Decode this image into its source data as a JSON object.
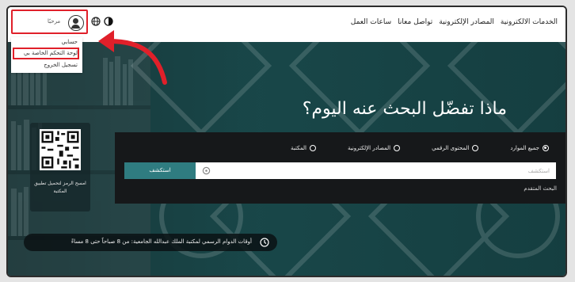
{
  "header": {
    "nav_items": [
      "الخدمات الالكترونية",
      "المصادر الإلكترونية",
      "تواصل معانا",
      "ساعات العمل"
    ],
    "username": "مرحبًا",
    "user_menu": {
      "profile": "حسابي",
      "dashboard": "لوحة التحكم الخاصة بي",
      "logout": "تسجيل الخروج"
    }
  },
  "hero": {
    "title": "ماذا تفضّل البحث عنه اليوم؟",
    "qr_caption": "امسح الرمز لتحميل تطبيق المكتبة"
  },
  "search": {
    "options": [
      {
        "label": "جميع الموارد",
        "selected": true
      },
      {
        "label": "المحتوى الرقمي",
        "selected": false
      },
      {
        "label": "المصادر الإلكترونية",
        "selected": false
      },
      {
        "label": "المكتبة",
        "selected": false
      }
    ],
    "placeholder": "استكشف",
    "button_label": "استكشف",
    "advanced_label": "البحث المتقدم"
  },
  "footer_notice": {
    "hours_text": "أوقات الدوام الرسمي لمكتبة الملك عبدالله الجامعية: من 8 صباحاً حتى 8 مساءً"
  },
  "colors": {
    "highlight": "#e0202a",
    "accent": "#2f7c80",
    "hero_overlay": "#1b4244",
    "panel": "#16181a"
  },
  "icons": [
    "user-avatar-icon",
    "globe-icon",
    "contrast-icon",
    "search-icon",
    "clock-icon",
    "qr-code-icon",
    "red-arrow-annotation"
  ]
}
